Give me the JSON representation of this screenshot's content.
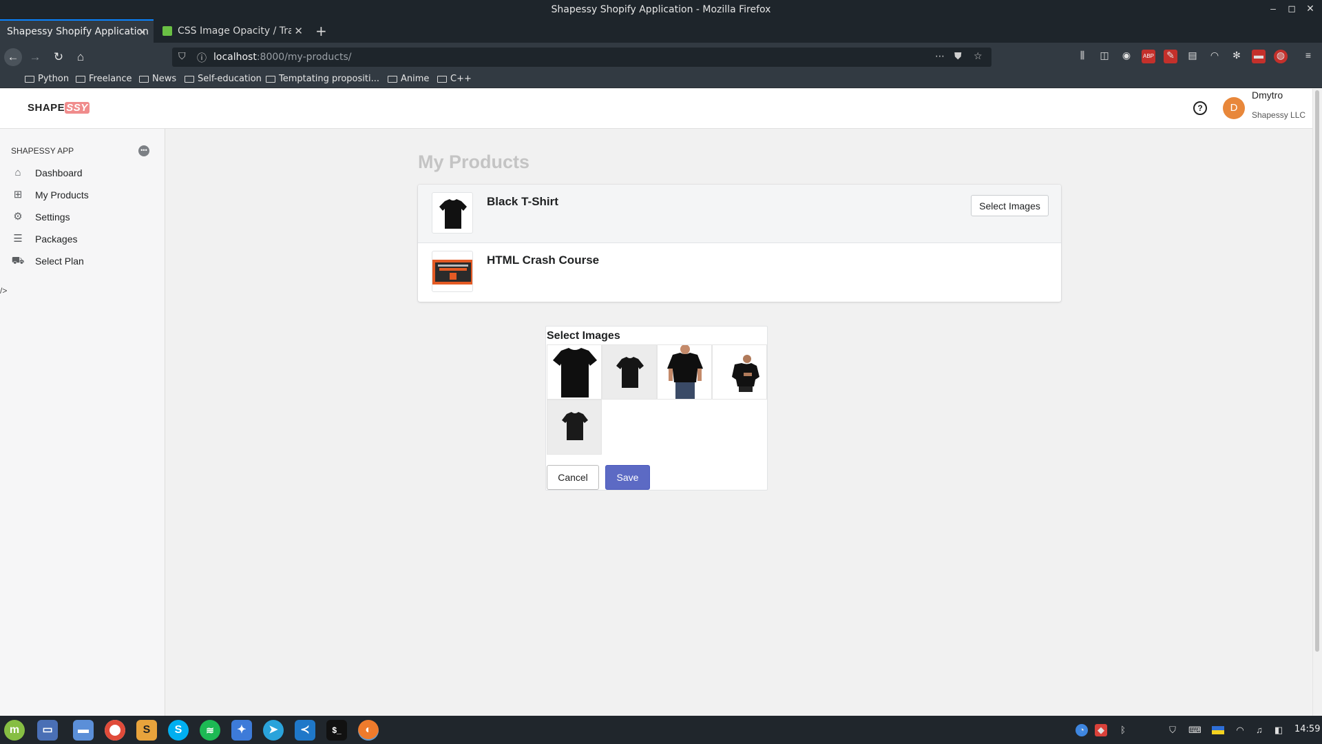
{
  "window": {
    "title": "Shapessy Shopify Application - Mozilla Firefox"
  },
  "tabs": [
    {
      "label": "Shapessy Shopify Application",
      "active": true
    },
    {
      "label": "CSS Image Opacity / Transp",
      "active": false
    }
  ],
  "address": {
    "host": "localhost",
    "path": ":8000/my-products/"
  },
  "bookmarks": [
    "Python",
    "Freelance",
    "News",
    "Self-education",
    "Temptating propositi...",
    "Anime",
    "C++"
  ],
  "app": {
    "logo": {
      "main": "SHAPE",
      "accent": "SSY"
    },
    "help_symbol": "?",
    "user": {
      "initial": "D",
      "name": "Dmytro",
      "company": "Shapessy LLC"
    },
    "accent_color": "#5c6ac4",
    "avatar_color": "#e8873a"
  },
  "sidebar": {
    "heading": "SHAPESSY APP",
    "items": [
      {
        "label": "Dashboard",
        "icon": "home-icon"
      },
      {
        "label": "My Products",
        "icon": "products-icon"
      },
      {
        "label": "Settings",
        "icon": "gear-icon"
      },
      {
        "label": "Packages",
        "icon": "packages-icon"
      },
      {
        "label": "Select Plan",
        "icon": "cart-icon"
      }
    ],
    "stray_text": "/>"
  },
  "page": {
    "title": "My Products",
    "products": [
      {
        "name": "Black T-Shirt",
        "action": "Select Images"
      },
      {
        "name": "HTML Crash Course"
      }
    ]
  },
  "modal": {
    "title": "Select Images",
    "image_count": 5,
    "cancel_label": "Cancel",
    "save_label": "Save"
  },
  "taskbar": {
    "clock": "14:59"
  }
}
